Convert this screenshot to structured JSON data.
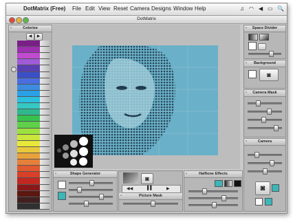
{
  "menubar": {
    "apple_glyph": "",
    "app_name": "DotMatrix (Free)",
    "menus": [
      "File",
      "Edit",
      "View",
      "Reset",
      "Camera",
      "Designs",
      "Window",
      "Help"
    ],
    "tray": {
      "music": "♫",
      "wifi": "◠",
      "volume": "◀",
      "battery": "▭",
      "search": "🔍"
    }
  },
  "window": {
    "title": "DotMatrix"
  },
  "colorize": {
    "title": "Colorize",
    "nav_prev": "◀",
    "nav_next": "▶",
    "swatches": [
      "#7a1f88",
      "#9d2fb0",
      "#c04ad0",
      "#a05bd8",
      "#5a3fb4",
      "#3a4fc8",
      "#4a6ee0",
      "#3d8ce0",
      "#2aa0e6",
      "#2bc0e0",
      "#35c9c2",
      "#2fb88e",
      "#36c24e",
      "#5ed04a",
      "#9ce23e",
      "#cbe63a",
      "#e8e83a",
      "#e8c83a",
      "#e8a23a",
      "#e4803a",
      "#e05a30",
      "#d84028",
      "#c02820",
      "#8a1818",
      "#5a1810",
      "#402020",
      "#303030"
    ]
  },
  "space_divider": {
    "title": "Space Divider"
  },
  "background": {
    "title": "Background"
  },
  "camera_mask": {
    "title": "Camera Mask"
  },
  "camera": {
    "title": "Camera"
  },
  "shape_generator": {
    "title": "Shape Generator"
  },
  "picture_mask": {
    "title": "Picture Mask"
  },
  "halftone_effects": {
    "title": "Halftone Effects"
  },
  "transport": {
    "rewind": "◀◀",
    "pause": "▌▌",
    "play": "▶"
  },
  "colors": {
    "canvas": "#5fa6c0",
    "canvas_dark": "#1e3a4c",
    "window_bg": "#c9c9c9",
    "panel_bg": "#b7b7b7"
  }
}
